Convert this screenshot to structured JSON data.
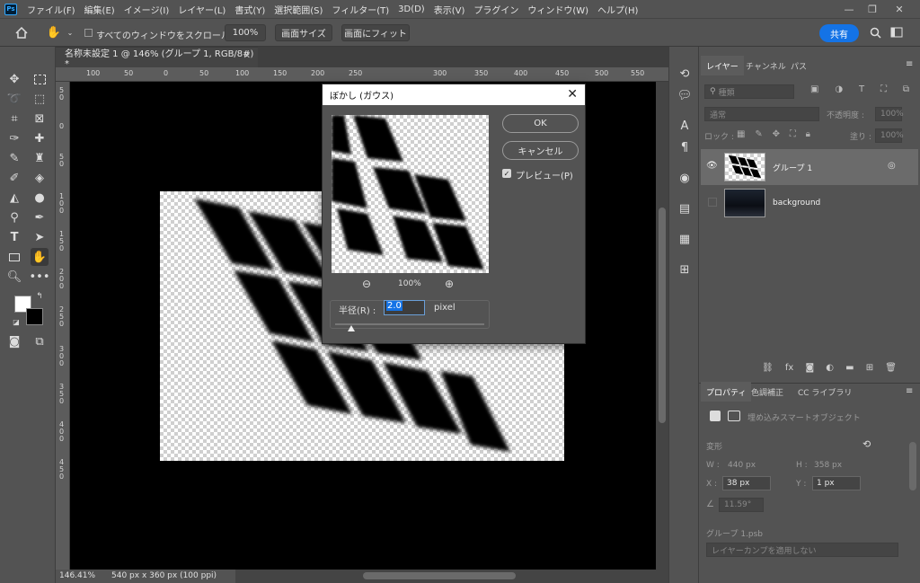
{
  "menu": {
    "items": [
      "ファイル(F)",
      "編集(E)",
      "イメージ(I)",
      "レイヤー(L)",
      "書式(Y)",
      "選択範囲(S)",
      "フィルター(T)",
      "3D(D)",
      "表示(V)",
      "プラグイン",
      "ウィンドウ(W)",
      "ヘルプ(H)"
    ],
    "logo": "Ps"
  },
  "options": {
    "scroll_all_label": "すべてのウィンドウをスクロール",
    "zoom_btn": "100%",
    "fit_screen": "画面サイズ",
    "fill_screen": "画面にフィット",
    "share": "共有"
  },
  "document": {
    "tab_title": "名称未設定 1 @ 146% (グループ 1, RGB/8#) *",
    "ruler_h": [
      "100",
      "50",
      "0",
      "50",
      "100",
      "150",
      "200",
      "250",
      "300",
      "350",
      "400",
      "450",
      "500",
      "550"
    ],
    "ruler_v": [
      "50",
      "0",
      "50",
      "100",
      "150",
      "200",
      "250",
      "300",
      "350",
      "400",
      "450"
    ],
    "zoom_status": "146.41%",
    "doc_info": "540 px x 360 px (100 ppi)"
  },
  "dialog": {
    "title": "ぼかし (ガウス)",
    "ok": "OK",
    "cancel": "キャンセル",
    "preview_label": "プレビュー(P)",
    "preview_checked": true,
    "zoom": "100%",
    "radius_label": "半径(R) :",
    "radius_value": "2.0",
    "radius_unit": "pixel"
  },
  "layers_panel": {
    "tabs": [
      "レイヤー",
      "チャンネル",
      "パス"
    ],
    "search_placeholder": "種類",
    "blend_mode": "通常",
    "opacity_label": "不透明度 :",
    "opacity_value": "100%",
    "lock_label": "ロック :",
    "fill_label": "塗り :",
    "fill_value": "100%",
    "layers": [
      {
        "name": "グループ 1",
        "visible": true,
        "selected": true
      },
      {
        "name": "background",
        "visible": false,
        "selected": false
      }
    ]
  },
  "properties_panel": {
    "tabs": [
      "プロパティ",
      "色調補正",
      "CC ライブラリ"
    ],
    "type_label": "埋め込みスマートオブジェクト",
    "transform_label": "変形",
    "w_label": "W :",
    "w_value": "440 px",
    "h_label": "H :",
    "h_value": "358 px",
    "x_label": "X :",
    "x_value": "38 px",
    "y_label": "Y :",
    "y_value": "1 px",
    "angle_value": "11.59°",
    "filename": "グループ 1.psb",
    "layer_comp": "レイヤーカンプを適用しない"
  },
  "colors": {
    "accent": "#1473e6",
    "panel_bg": "#535353",
    "canvas_bg": "#000000"
  }
}
